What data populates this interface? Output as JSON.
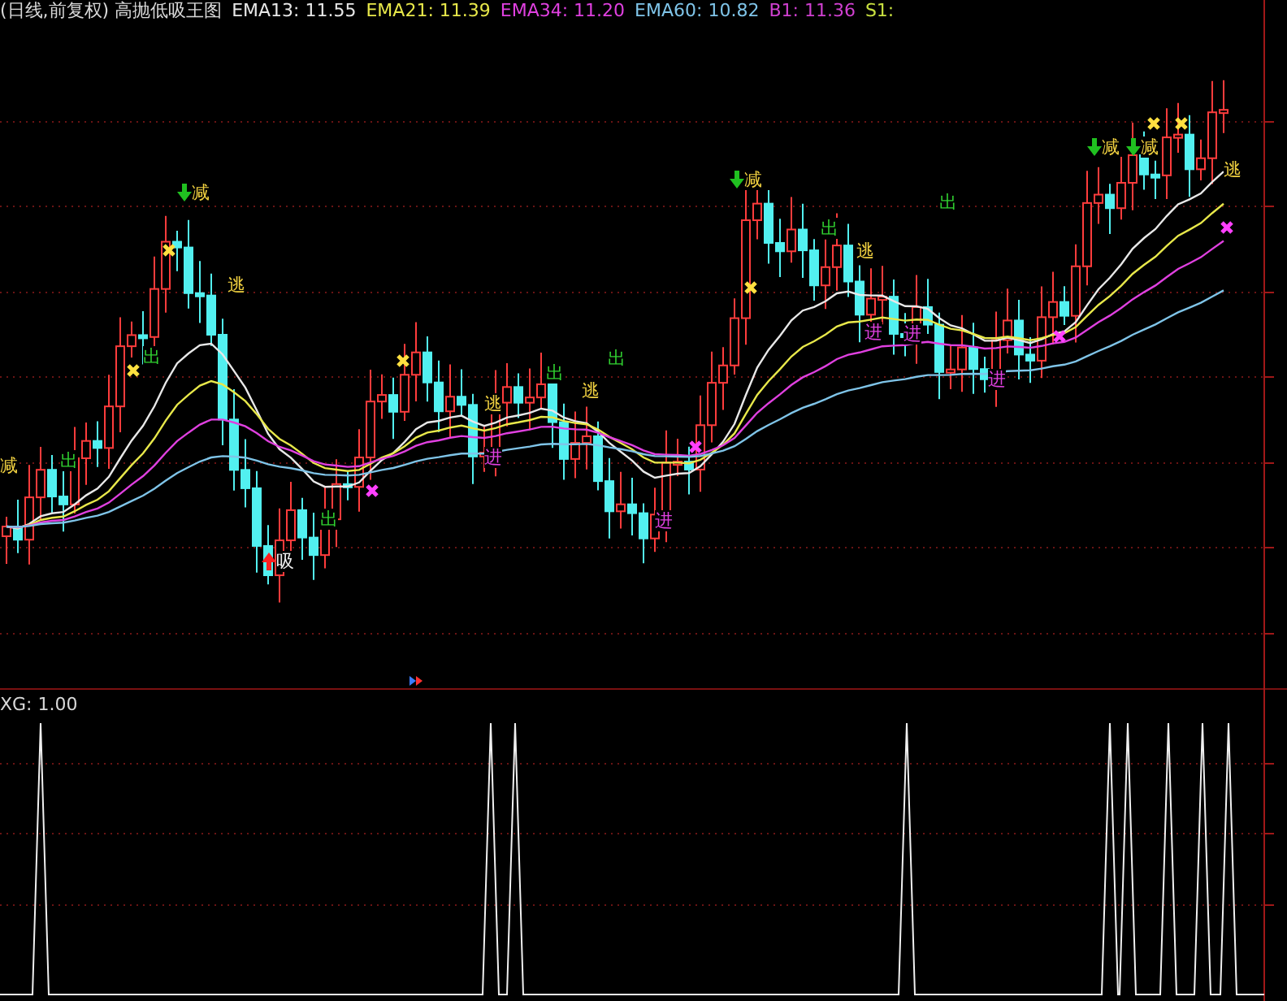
{
  "price_panel": {
    "title": "(日线,前复权) 高抛低吸王图",
    "indicators": [
      {
        "label": "EMA13: 11.55",
        "color": "#e8e8e8"
      },
      {
        "label": "EMA21: 11.39",
        "color": "#e8e84a"
      },
      {
        "label": "EMA34: 11.20",
        "color": "#e040e0"
      },
      {
        "label": "EMA60: 10.82",
        "color": "#7fc4e8"
      },
      {
        "label": "B1: 11.36",
        "color": "#d040d0"
      },
      {
        "label": "S1:",
        "color": "#c8e040"
      }
    ],
    "signals": [
      {
        "text": "减",
        "kind": "plain-yellow"
      },
      {
        "text": "出",
        "kind": "out"
      },
      {
        "text": "出",
        "kind": "out"
      },
      {
        "text": "减",
        "kind": "sell-arrow"
      },
      {
        "text": "逃",
        "kind": "escape"
      },
      {
        "text": "吸",
        "kind": "buy-arrow"
      },
      {
        "text": "出",
        "kind": "out"
      },
      {
        "text": "逃",
        "kind": "escape"
      },
      {
        "text": "进",
        "kind": "enter"
      },
      {
        "text": "出",
        "kind": "out"
      },
      {
        "text": "逃",
        "kind": "escape"
      },
      {
        "text": "出",
        "kind": "out"
      },
      {
        "text": "进",
        "kind": "enter"
      },
      {
        "text": "减",
        "kind": "sell-arrow"
      },
      {
        "text": "出",
        "kind": "out"
      },
      {
        "text": "逃",
        "kind": "escape"
      },
      {
        "text": "进",
        "kind": "enter"
      },
      {
        "text": "进",
        "kind": "enter"
      },
      {
        "text": "出",
        "kind": "out"
      },
      {
        "text": "进",
        "kind": "enter"
      },
      {
        "text": "减",
        "kind": "sell-arrow"
      },
      {
        "text": "减",
        "kind": "sell-arrow"
      },
      {
        "text": "逃",
        "kind": "escape"
      }
    ]
  },
  "signal_panel": {
    "label": "XG: 1.00"
  }
}
